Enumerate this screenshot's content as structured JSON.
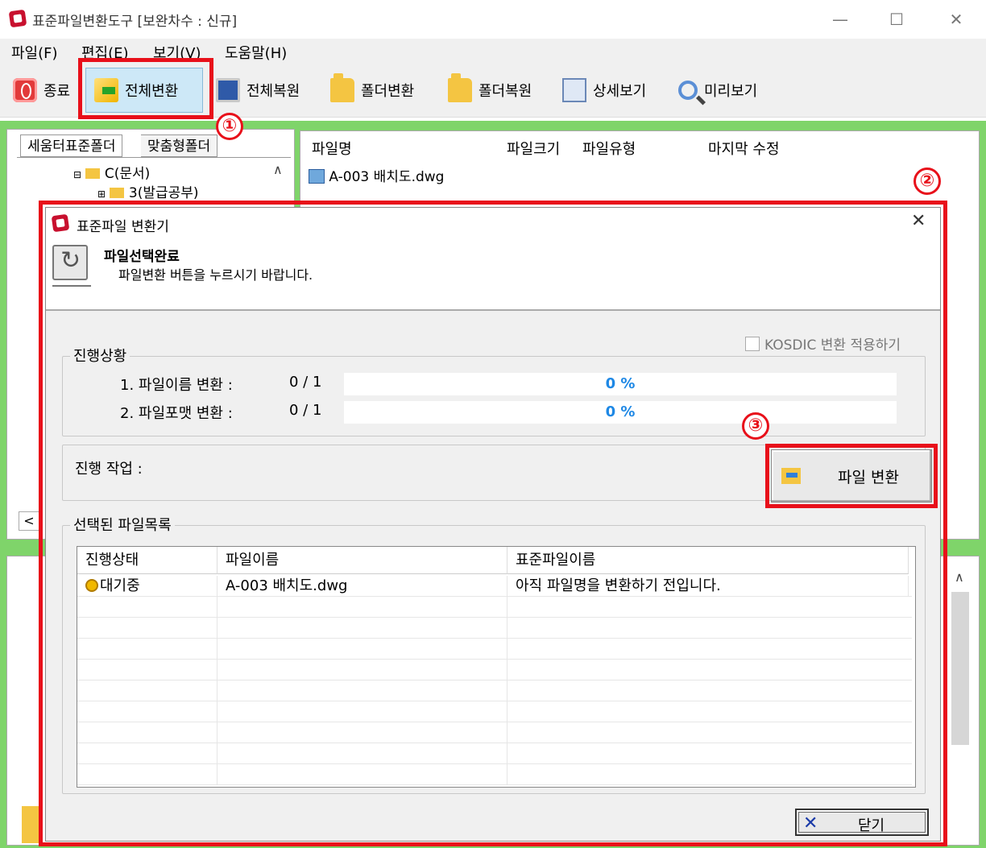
{
  "window": {
    "title": "표준파일변환도구 [보완차수 : 신규]",
    "controls": {
      "minimize": "—",
      "maximize": "☐",
      "close": "✕"
    }
  },
  "menu": [
    "파일(F)",
    "편집(E)",
    "보기(V)",
    "도움말(H)"
  ],
  "toolbar": {
    "exit": "종료",
    "convert_all": "전체변환",
    "restore_all": "전체복원",
    "folder_convert": "폴더변환",
    "folder_restore": "폴더복원",
    "detail_view": "상세보기",
    "preview": "미리보기"
  },
  "annotations": {
    "one": "①",
    "two": "②",
    "three": "③"
  },
  "left_panel": {
    "tabs": [
      "세움터표준폴더",
      "맞춤형폴더"
    ],
    "tree": [
      "C(문서)",
      "3(발급공부)"
    ]
  },
  "right_panel": {
    "columns": [
      "파일명",
      "파일크기",
      "파일유형",
      "마지막 수정"
    ],
    "files": [
      "A-003 배치도.dwg"
    ]
  },
  "dialog": {
    "title": "표준파일 변환기",
    "header_title": "파일선택완료",
    "header_subtitle": "파일변환 버튼을 누르시기 바랍니다.",
    "kosdic_label": "KOSDIC 변환 적용하기",
    "progress_group": "진행상황",
    "progress": [
      {
        "label": "1. 파일이름 변환 :",
        "count": "0 / 1",
        "percent_text": "0 %",
        "fraction": 0
      },
      {
        "label": "2. 파일포맷 변환 :",
        "count": "0 / 1",
        "percent_text": "0 %",
        "fraction": 0
      }
    ],
    "task_label": "진행 작업 :",
    "convert_button": "파일 변환",
    "file_list_group": "선택된 파일목록",
    "table": {
      "columns": [
        "진행상태",
        "파일이름",
        "표준파일이름"
      ],
      "rows": [
        {
          "status": "대기중",
          "file": "A-003 배치도.dwg",
          "std_name": "아직 파일명을 변환하기 전입니다."
        }
      ]
    },
    "close_button": "닫기"
  },
  "colors": {
    "accent_highlight": "#e8101a",
    "workspace": "#7fd46a",
    "progress_text": "#1e88e5"
  }
}
